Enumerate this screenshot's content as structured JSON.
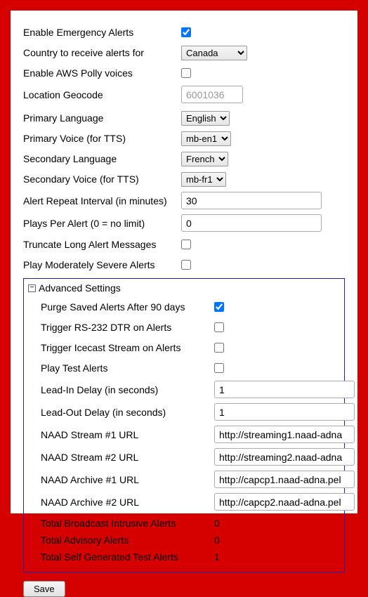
{
  "main": {
    "enable_emergency_alerts_label": "Enable Emergency Alerts",
    "enable_emergency_alerts_checked": true,
    "country_label": "Country to receive alerts for",
    "country_value": "Canada",
    "enable_aws_polly_label": "Enable AWS Polly voices",
    "enable_aws_polly_checked": false,
    "location_geocode_label": "Location Geocode",
    "location_geocode_placeholder": "6001036",
    "location_geocode_value": "",
    "primary_language_label": "Primary Language",
    "primary_language_value": "English",
    "primary_voice_label": "Primary Voice (for TTS)",
    "primary_voice_value": "mb-en1",
    "secondary_language_label": "Secondary Language",
    "secondary_language_value": "French",
    "secondary_voice_label": "Secondary Voice (for TTS)",
    "secondary_voice_value": "mb-fr1",
    "alert_repeat_label": "Alert Repeat Interval (in minutes)",
    "alert_repeat_value": "30",
    "plays_per_alert_label": "Plays Per Alert (0 = no limit)",
    "plays_per_alert_value": "0",
    "truncate_label": "Truncate Long Alert Messages",
    "truncate_checked": false,
    "play_moderate_label": "Play Moderately Severe Alerts",
    "play_moderate_checked": false
  },
  "advanced": {
    "title": "Advanced Settings",
    "expander_glyph": "⊟",
    "purge_label": "Purge Saved Alerts After 90 days",
    "purge_checked": true,
    "trigger_rs232_label": "Trigger RS-232 DTR on Alerts",
    "trigger_rs232_checked": false,
    "trigger_icecast_label": "Trigger Icecast Stream on Alerts",
    "trigger_icecast_checked": false,
    "play_test_label": "Play Test Alerts",
    "play_test_checked": false,
    "lead_in_label": "Lead-In Delay (in seconds)",
    "lead_in_value": "1",
    "lead_out_label": "Lead-Out Delay (in seconds)",
    "lead_out_value": "1",
    "naad_stream1_label": "NAAD Stream #1 URL",
    "naad_stream1_value": "http://streaming1.naad-adna",
    "naad_stream2_label": "NAAD Stream #2 URL",
    "naad_stream2_value": "http://streaming2.naad-adna",
    "naad_archive1_label": "NAAD Archive #1 URL",
    "naad_archive1_value": "http://capcp1.naad-adna.pel",
    "naad_archive2_label": "NAAD Archive #2 URL",
    "naad_archive2_value": "http://capcp2.naad-adna.pel",
    "total_broadcast_label": "Total Broadcast Intrusive Alerts",
    "total_broadcast_value": "0",
    "total_advisory_label": "Total Advisory Alerts",
    "total_advisory_value": "0",
    "total_selftest_label": "Total Self Generated Test Alerts",
    "total_selftest_value": "1"
  },
  "buttons": {
    "save_label": "Save"
  }
}
